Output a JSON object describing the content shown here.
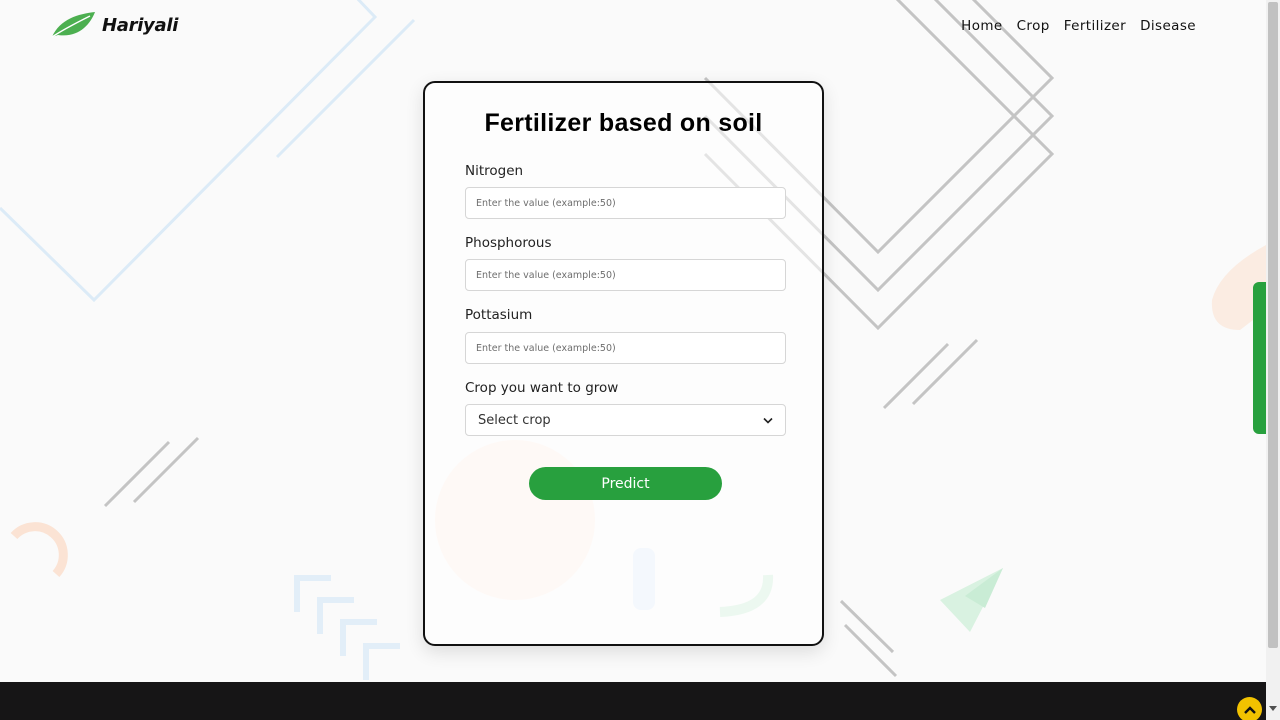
{
  "brand": {
    "name": "Hariyali",
    "icon": "leaf-icon",
    "color": "#28a03e"
  },
  "nav": {
    "items": [
      {
        "label": "Home"
      },
      {
        "label": "Crop"
      },
      {
        "label": "Fertilizer"
      },
      {
        "label": "Disease"
      }
    ]
  },
  "form": {
    "title": "Fertilizer based on soil",
    "fields": [
      {
        "label": "Nitrogen",
        "placeholder": "Enter the value (example:50)",
        "value": ""
      },
      {
        "label": "Phosphorous",
        "placeholder": "Enter the value (example:50)",
        "value": ""
      },
      {
        "label": "Pottasium",
        "placeholder": "Enter the value (example:50)",
        "value": ""
      }
    ],
    "crop": {
      "label": "Crop you want to grow",
      "selected": "Select crop"
    },
    "submit_label": "Predict"
  },
  "colors": {
    "accent": "#28a03e",
    "footer": "#161516",
    "back_to_top": "#f2c200"
  }
}
